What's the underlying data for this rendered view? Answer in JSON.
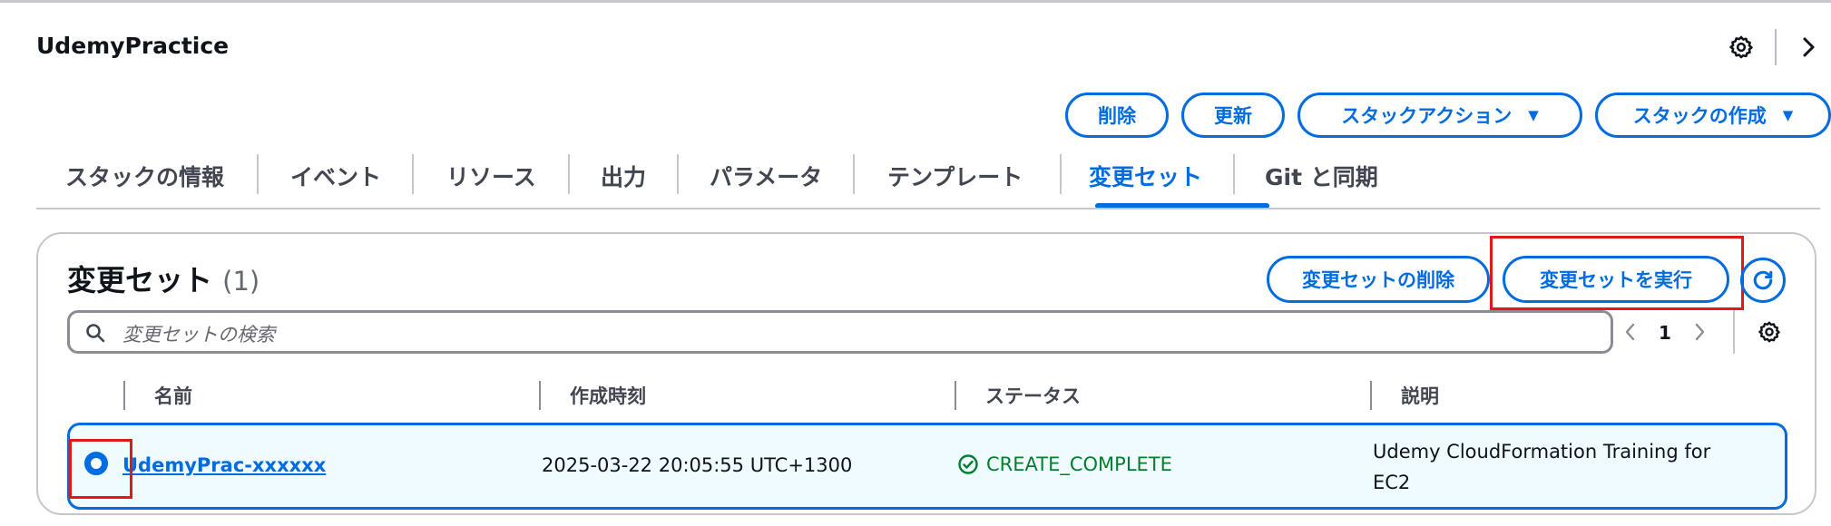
{
  "header": {
    "title": "UdemyPractice",
    "actions": {
      "delete": "削除",
      "update": "更新",
      "stack_actions": "スタックアクション",
      "create_stack": "スタックの作成",
      "caret": "▼"
    }
  },
  "tabs": [
    {
      "label": "スタックの情報",
      "active": false
    },
    {
      "label": "イベント",
      "active": false
    },
    {
      "label": "リソース",
      "active": false
    },
    {
      "label": "出力",
      "active": false
    },
    {
      "label": "パラメータ",
      "active": false
    },
    {
      "label": "テンプレート",
      "active": false
    },
    {
      "label": "変更セット",
      "active": true
    },
    {
      "label": "Git と同期",
      "active": false
    }
  ],
  "panel": {
    "title": "変更セット",
    "count": "(1)",
    "delete_button": "変更セットの削除",
    "execute_button": "変更セットを実行",
    "search_placeholder": "変更セットの検索",
    "page_number": "1",
    "columns": [
      "名前",
      "作成時刻",
      "ステータス",
      "説明"
    ],
    "rows": [
      {
        "name": "UdemyPrac-xxxxxx",
        "created": "2025-03-22 20:05:55 UTC+1300",
        "status": "CREATE_COMPLETE",
        "description": "Udemy CloudFormation Training for EC2",
        "selected": true
      }
    ]
  },
  "colors": {
    "accent": "#006ce0",
    "success": "#00802f",
    "highlight": "#e01818",
    "selected_row_bg": "#f0fbff"
  },
  "icons": [
    "gear-icon",
    "chevron-right-icon",
    "search-icon",
    "refresh-icon",
    "chevron-left-icon",
    "status-success-icon"
  ]
}
